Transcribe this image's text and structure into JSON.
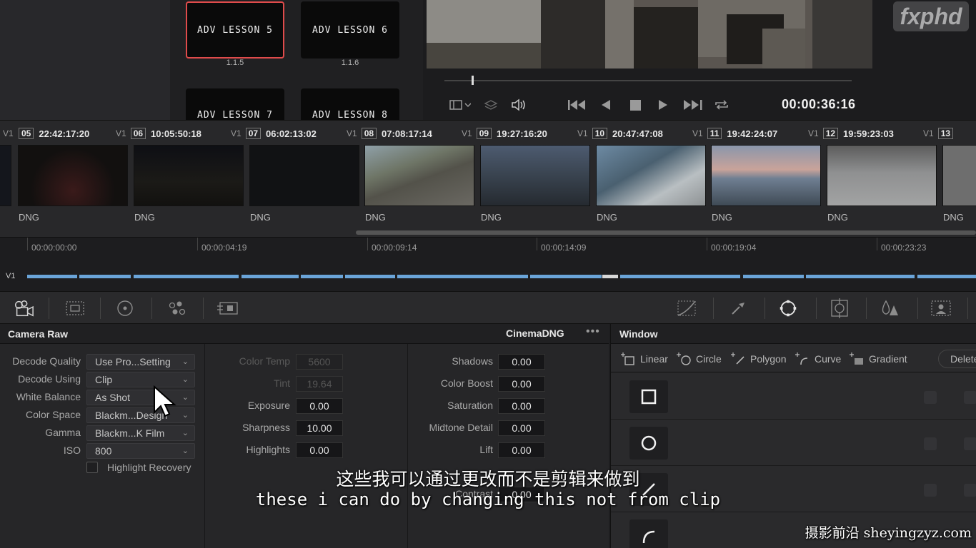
{
  "gallery": {
    "stills": [
      {
        "label": "ADV LESSON 5",
        "num": "1.1.5",
        "selected": true
      },
      {
        "label": "ADV LESSON 6",
        "num": "1.1.6",
        "selected": false
      },
      {
        "label": "ADV LESSON 7",
        "num": "",
        "selected": false
      },
      {
        "label": "ADV LESSON 8",
        "num": "",
        "selected": false
      }
    ]
  },
  "viewer": {
    "timecode": "00:00:36:16",
    "logo": "fxphd",
    "playhead_fraction": 0.07
  },
  "clips": [
    {
      "track": "V1",
      "num": "05",
      "tc": "22:42:17:20",
      "format": "DNG"
    },
    {
      "track": "V1",
      "num": "06",
      "tc": "10:05:50:18",
      "format": "DNG"
    },
    {
      "track": "V1",
      "num": "07",
      "tc": "06:02:13:02",
      "format": "DNG"
    },
    {
      "track": "V1",
      "num": "08",
      "tc": "07:08:17:14",
      "format": "DNG"
    },
    {
      "track": "V1",
      "num": "09",
      "tc": "19:27:16:20",
      "format": "DNG"
    },
    {
      "track": "V1",
      "num": "10",
      "tc": "20:47:47:08",
      "format": "DNG"
    },
    {
      "track": "V1",
      "num": "11",
      "tc": "19:42:24:07",
      "format": "DNG"
    },
    {
      "track": "V1",
      "num": "12",
      "tc": "19:59:23:03",
      "format": "DNG"
    },
    {
      "track": "V1",
      "num": "13",
      "tc": "",
      "format": "DNG"
    }
  ],
  "first_clip_format": "DNG",
  "timeline": {
    "track_label": "V1",
    "ruler": [
      "00:00:00:00",
      "00:00:04:19",
      "00:00:09:14",
      "00:00:14:09",
      "00:00:19:04",
      "00:00:23:23"
    ]
  },
  "camera_raw": {
    "title": "Camera Raw",
    "mode": "CinemaDNG",
    "menu_dots": "•••",
    "decode": [
      {
        "label": "Decode Quality",
        "value": "Use Pro...Setting"
      },
      {
        "label": "Decode Using",
        "value": "Clip"
      },
      {
        "label": "White Balance",
        "value": "As Shot"
      },
      {
        "label": "Color Space",
        "value": "Blackm...Design"
      },
      {
        "label": "Gamma",
        "value": "Blackm...K Film"
      },
      {
        "label": "ISO",
        "value": "800"
      }
    ],
    "highlight_recovery": "Highlight Recovery",
    "middle": [
      {
        "label": "Color Temp",
        "value": "5600",
        "dim": true
      },
      {
        "label": "Tint",
        "value": "19.64",
        "dim": true
      },
      {
        "label": "Exposure",
        "value": "0.00",
        "dim": false
      },
      {
        "label": "Sharpness",
        "value": "10.00",
        "dim": false
      },
      {
        "label": "Highlights",
        "value": "0.00",
        "dim": false
      }
    ],
    "right": [
      {
        "label": "Shadows",
        "value": "0.00"
      },
      {
        "label": "Color Boost",
        "value": "0.00"
      },
      {
        "label": "Saturation",
        "value": "0.00"
      },
      {
        "label": "Midtone Detail",
        "value": "0.00"
      },
      {
        "label": "Lift",
        "value": "0.00"
      },
      {
        "label": "Contrast",
        "value": "0.00"
      }
    ]
  },
  "window_panel": {
    "title": "Window",
    "tools": [
      "Linear",
      "Circle",
      "Polygon",
      "Curve",
      "Gradient"
    ],
    "delete": "Delete"
  },
  "subtitles": {
    "chinese": "这些我可以通过更改而不是剪辑来做到",
    "english": "these i can do by changing this not from clip"
  },
  "watermark": "摄影前沿 sheyingzyz.com"
}
